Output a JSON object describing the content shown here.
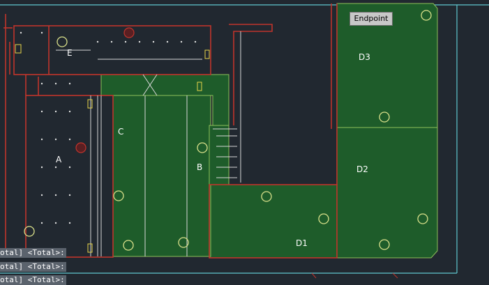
{
  "rooms": {
    "a": "A",
    "b": "B",
    "c": "C",
    "d1": "D1",
    "d2": "D2",
    "d3": "D3",
    "e": "E"
  },
  "snap_tooltip": "Endpoint",
  "command_history": [
    "otal] <Total>:",
    "otal] <Total>:",
    "otal] <Total>:"
  ],
  "colors": {
    "background": "#212830",
    "area_fill": "#1e5c2a",
    "wall_red": "#c0342c",
    "outline_cyan": "#5fc7cf",
    "line_white": "#d8d8d8",
    "circle_yellow": "#d9e08a"
  }
}
